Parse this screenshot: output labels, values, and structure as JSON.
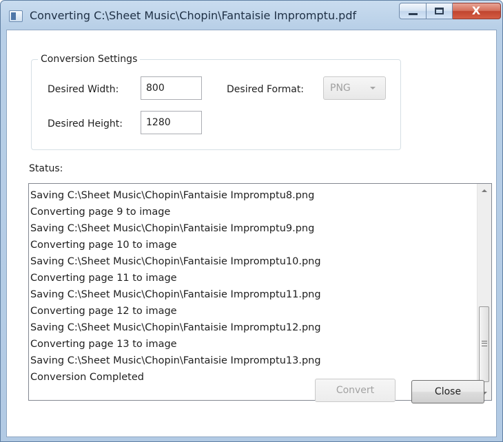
{
  "window": {
    "title": "Converting C:\\Sheet Music\\Chopin\\Fantaisie Impromptu.pdf",
    "close_glyph": "X"
  },
  "settings": {
    "group_label": "Conversion Settings",
    "width_label": "Desired Width:",
    "width_value": "800",
    "height_label": "Desired Height:",
    "height_value": "1280",
    "format_label": "Desired Format:",
    "format_value": "PNG"
  },
  "status": {
    "label": "Status:",
    "lines": [
      "Saving C:\\Sheet Music\\Chopin\\Fantaisie Impromptu8.png",
      "Converting page 9 to image",
      "Saving C:\\Sheet Music\\Chopin\\Fantaisie Impromptu9.png",
      "Converting page 10 to image",
      "Saving C:\\Sheet Music\\Chopin\\Fantaisie Impromptu10.png",
      "Converting page 11 to image",
      "Saving C:\\Sheet Music\\Chopin\\Fantaisie Impromptu11.png",
      "Converting page 12 to image",
      "Saving C:\\Sheet Music\\Chopin\\Fantaisie Impromptu12.png",
      "Converting page 13 to image",
      "Saving C:\\Sheet Music\\Chopin\\Fantaisie Impromptu13.png",
      "Conversion Completed"
    ]
  },
  "buttons": {
    "convert_label": "Convert",
    "close_label": "Close"
  }
}
